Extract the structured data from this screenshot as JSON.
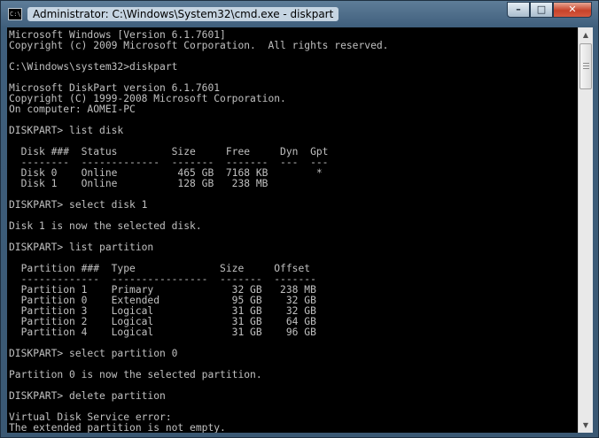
{
  "window": {
    "title": "Administrator: C:\\Windows\\System32\\cmd.exe - diskpart",
    "app_icon_text": "C:\\",
    "app_icon": "cmd-prompt-icon",
    "controls": {
      "minimize_icon": "minimize-icon",
      "maximize_icon": "maximize-icon",
      "close_icon": "close-icon"
    }
  },
  "console": {
    "lines": [
      "Microsoft Windows [Version 6.1.7601]",
      "Copyright (c) 2009 Microsoft Corporation.  All rights reserved.",
      "",
      "C:\\Windows\\system32>diskpart",
      "",
      "Microsoft DiskPart version 6.1.7601",
      "Copyright (C) 1999-2008 Microsoft Corporation.",
      "On computer: AOMEI-PC",
      "",
      "DISKPART> list disk",
      "",
      "  Disk ###  Status         Size     Free     Dyn  Gpt",
      "  --------  -------------  -------  -------  ---  ---",
      "  Disk 0    Online          465 GB  7168 KB        *",
      "  Disk 1    Online          128 GB   238 MB",
      "",
      "DISKPART> select disk 1",
      "",
      "Disk 1 is now the selected disk.",
      "",
      "DISKPART> list partition",
      "",
      "  Partition ###  Type              Size     Offset",
      "  -------------  ----------------  -------  -------",
      "  Partition 1    Primary             32 GB   238 MB",
      "  Partition 0    Extended            95 GB    32 GB",
      "  Partition 3    Logical             31 GB    32 GB",
      "  Partition 2    Logical             31 GB    64 GB",
      "  Partition 4    Logical             31 GB    96 GB",
      "",
      "DISKPART> select partition 0",
      "",
      "Partition 0 is now the selected partition.",
      "",
      "DISKPART> delete partition",
      "",
      "Virtual Disk Service error:",
      "The extended partition is not empty."
    ]
  },
  "scrollbar": {
    "up_icon": "scroll-up-arrow-icon",
    "down_icon": "scroll-down-arrow-icon"
  },
  "colors": {
    "console_bg": "#000000",
    "console_fg": "#C0C0C0",
    "close_button": "#C7432A"
  }
}
